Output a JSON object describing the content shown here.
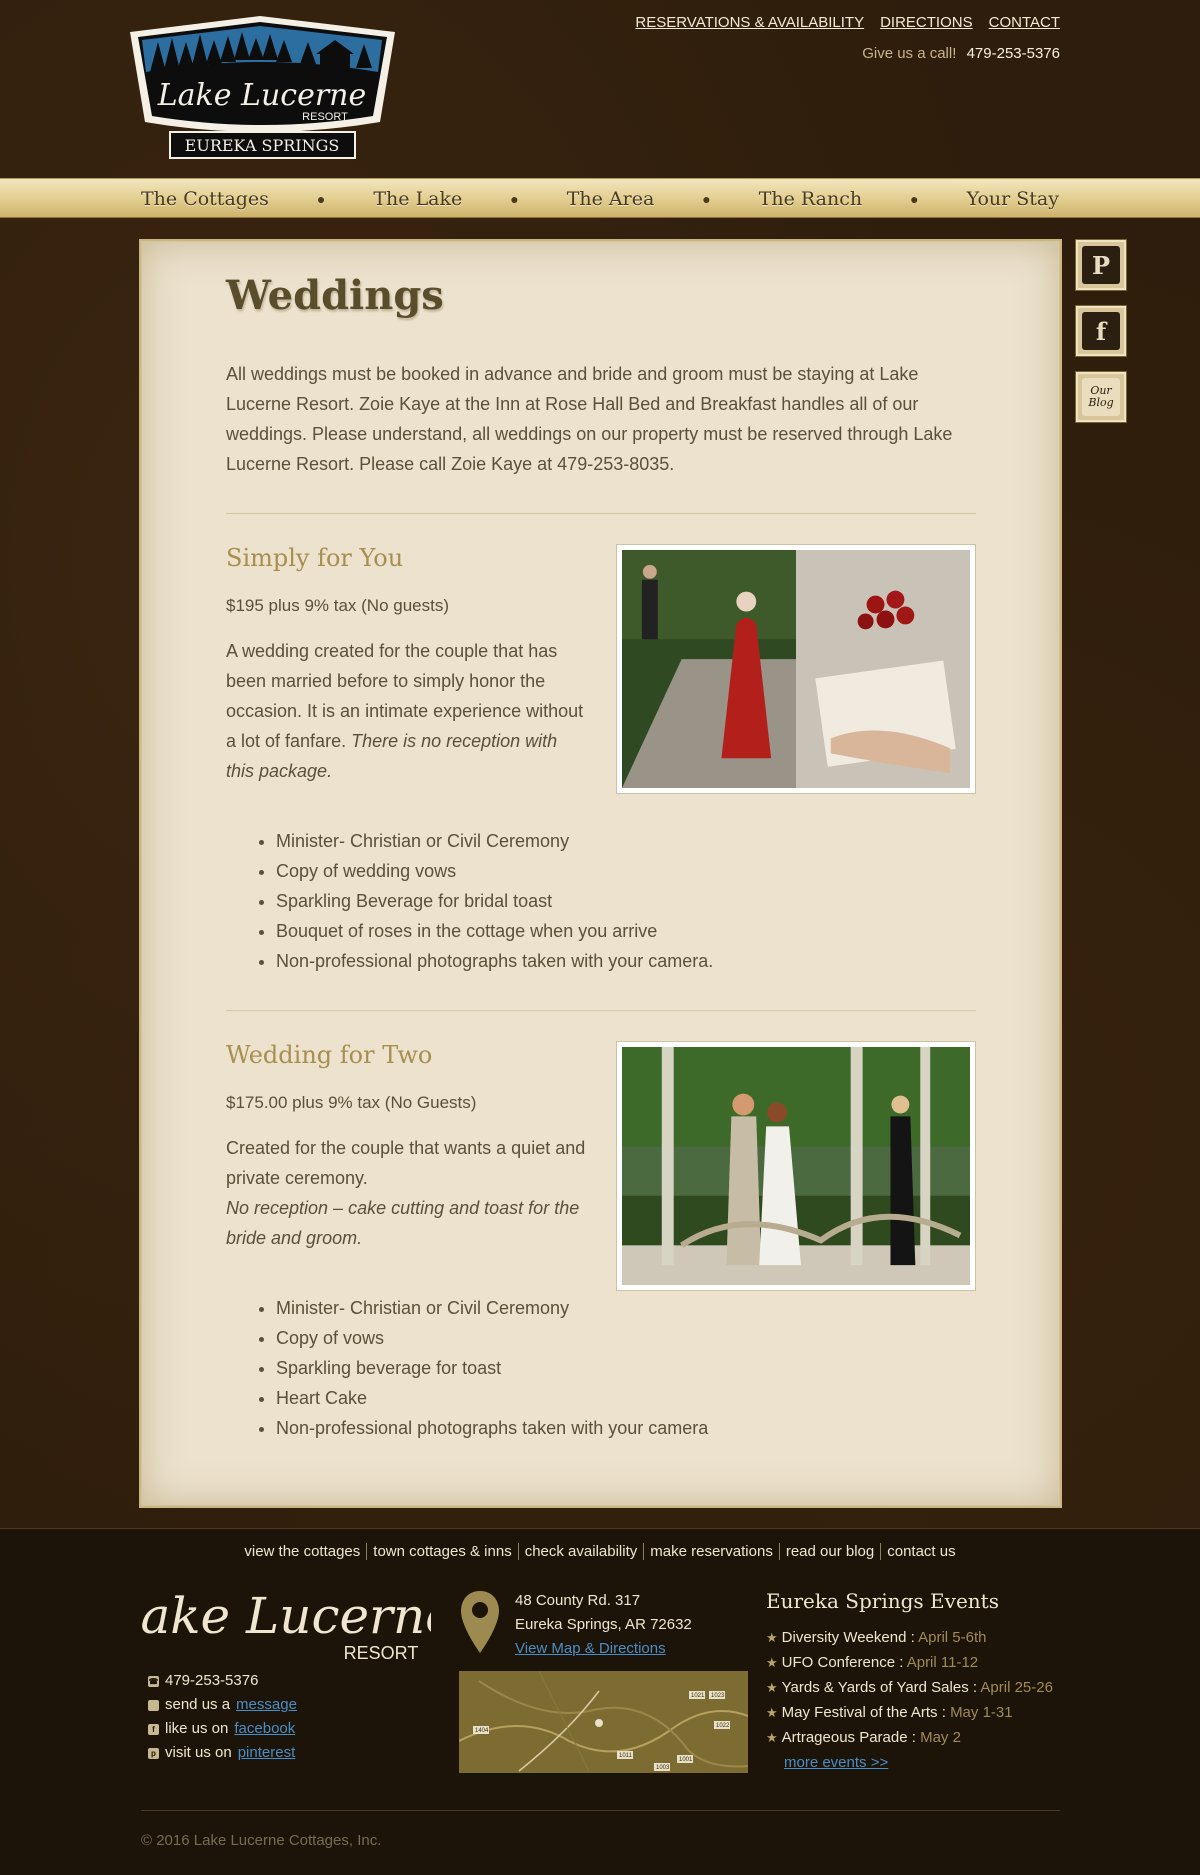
{
  "header": {
    "logo": {
      "line1": "Lake Lucerne",
      "line2": "RESORT",
      "line3": "EUREKA SPRINGS"
    },
    "top_links": [
      "RESERVATIONS & AVAILABILITY",
      "DIRECTIONS",
      "CONTACT"
    ],
    "call_label": "Give us a call!",
    "phone": "479-253-5376"
  },
  "nav": {
    "items": [
      "The Cottages",
      "The Lake",
      "The Area",
      "The Ranch",
      "Your Stay"
    ]
  },
  "social": {
    "pinterest": "P",
    "facebook": "f",
    "blog_line1": "Our",
    "blog_line2": "Blog"
  },
  "main": {
    "title": "Weddings",
    "intro": "All weddings must be booked in advance and bride and groom must be staying at Lake Lucerne Resort. Zoie Kaye at the Inn at Rose Hall Bed and Breakfast handles all of our weddings. Please understand, all weddings on our property must be reserved through Lake Lucerne Resort. Please call Zoie Kaye at 479-253-8035.",
    "packages": [
      {
        "title": "Simply for You",
        "price": "$195 plus 9% tax (No guests)",
        "desc": "A wedding created for the couple that has been married before to simply honor the occasion. It is an intimate experience without a lot of fanfare. ",
        "desc_italic": "There is no reception with this package.",
        "features": [
          "Minister- Christian or Civil Ceremony",
          "Copy of wedding vows",
          "Sparkling Beverage for bridal toast",
          "Bouquet of roses in the cottage when you arrive",
          "Non-professional photographs taken with your camera."
        ]
      },
      {
        "title": "Wedding for Two",
        "price": "$175.00 plus 9% tax (No Guests)",
        "desc": "Created for the couple that wants a quiet and private ceremony.",
        "desc_italic": "No reception – cake cutting and toast for the bride and groom.",
        "features": [
          "Minister- Christian or Civil Ceremony",
          "Copy of vows",
          "Sparkling beverage for toast",
          "Heart Cake",
          "Non-professional photographs taken with your camera"
        ]
      }
    ]
  },
  "footer": {
    "nav": [
      "view the cottages",
      "town cottages & inns",
      "check availability",
      "make reservations",
      "read our blog",
      "contact us"
    ],
    "logo": {
      "line1": "Lake Lucerne",
      "line2": "RESORT"
    },
    "contact": {
      "phone": "479-253-5376",
      "message_prefix": "send us a",
      "message_link": "message",
      "facebook_prefix": "like us on",
      "facebook_link": "facebook",
      "pinterest_prefix": "visit us on",
      "pinterest_link": "pinterest"
    },
    "address": {
      "line1": "48 County Rd. 317",
      "line2": "Eureka Springs, AR  72632",
      "map_link": "View Map & Directions"
    },
    "map_labels": [
      "1404",
      "1021",
      "1023",
      "1022",
      "1011",
      "1001",
      "1003"
    ],
    "events": {
      "title": "Eureka Springs Events",
      "items": [
        {
          "name": "Diversity Weekend :",
          "date": "April 5-6th"
        },
        {
          "name": "UFO Conference :",
          "date": "April 11-12"
        },
        {
          "name": "Yards & Yards of Yard Sales :",
          "date": "April 25-26"
        },
        {
          "name": "May Festival of the Arts :",
          "date": "May 1-31"
        },
        {
          "name": "Artrageous Parade :",
          "date": "May 2"
        }
      ],
      "more": "more events >>"
    },
    "copyright": "© 2016 Lake Lucerne Cottages, Inc."
  }
}
